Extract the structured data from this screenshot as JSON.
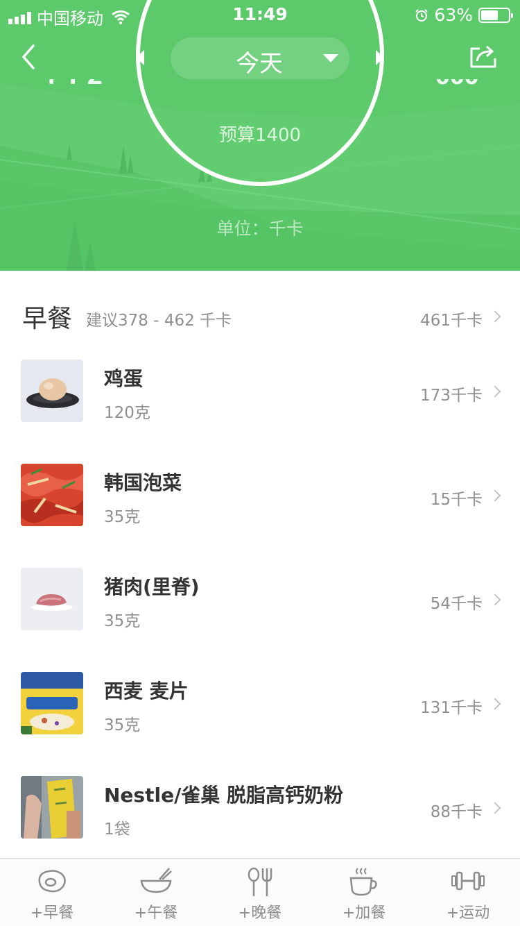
{
  "status_bar": {
    "carrier": "中国移动",
    "time": "11:49",
    "battery": "63%",
    "battery_level": 0.63
  },
  "nav": {
    "date_label": "今天"
  },
  "summary": {
    "budget": "预算1400",
    "unit": "单位：千卡"
  },
  "meal": {
    "title": "早餐",
    "suggestion": "建议378 - 462 千卡",
    "total": "461千卡"
  },
  "foods": [
    {
      "name": "鸡蛋",
      "amount": "120克",
      "calories": "173千卡",
      "thumb": "egg"
    },
    {
      "name": "韩国泡菜",
      "amount": "35克",
      "calories": "15千卡",
      "thumb": "kimchi"
    },
    {
      "name": "猪肉(里脊)",
      "amount": "35克",
      "calories": "54千卡",
      "thumb": "pork"
    },
    {
      "name": "西麦 麦片",
      "amount": "35克",
      "calories": "131千卡",
      "thumb": "oatmeal"
    },
    {
      "name": "Nestle/雀巢 脱脂高钙奶粉",
      "amount": "1袋",
      "calories": "88千卡",
      "thumb": "milk-powder"
    }
  ],
  "tabbar": [
    {
      "label": "+早餐",
      "icon": "egg-icon"
    },
    {
      "label": "+午餐",
      "icon": "bowl-icon"
    },
    {
      "label": "+晚餐",
      "icon": "spoon-fork-icon"
    },
    {
      "label": "+加餐",
      "icon": "coffee-cup-icon"
    },
    {
      "label": "+运动",
      "icon": "dumbbell-icon"
    }
  ],
  "colors": {
    "header_green": "#5cc96b",
    "text_primary": "#333333",
    "text_secondary": "#8f8f8f"
  }
}
